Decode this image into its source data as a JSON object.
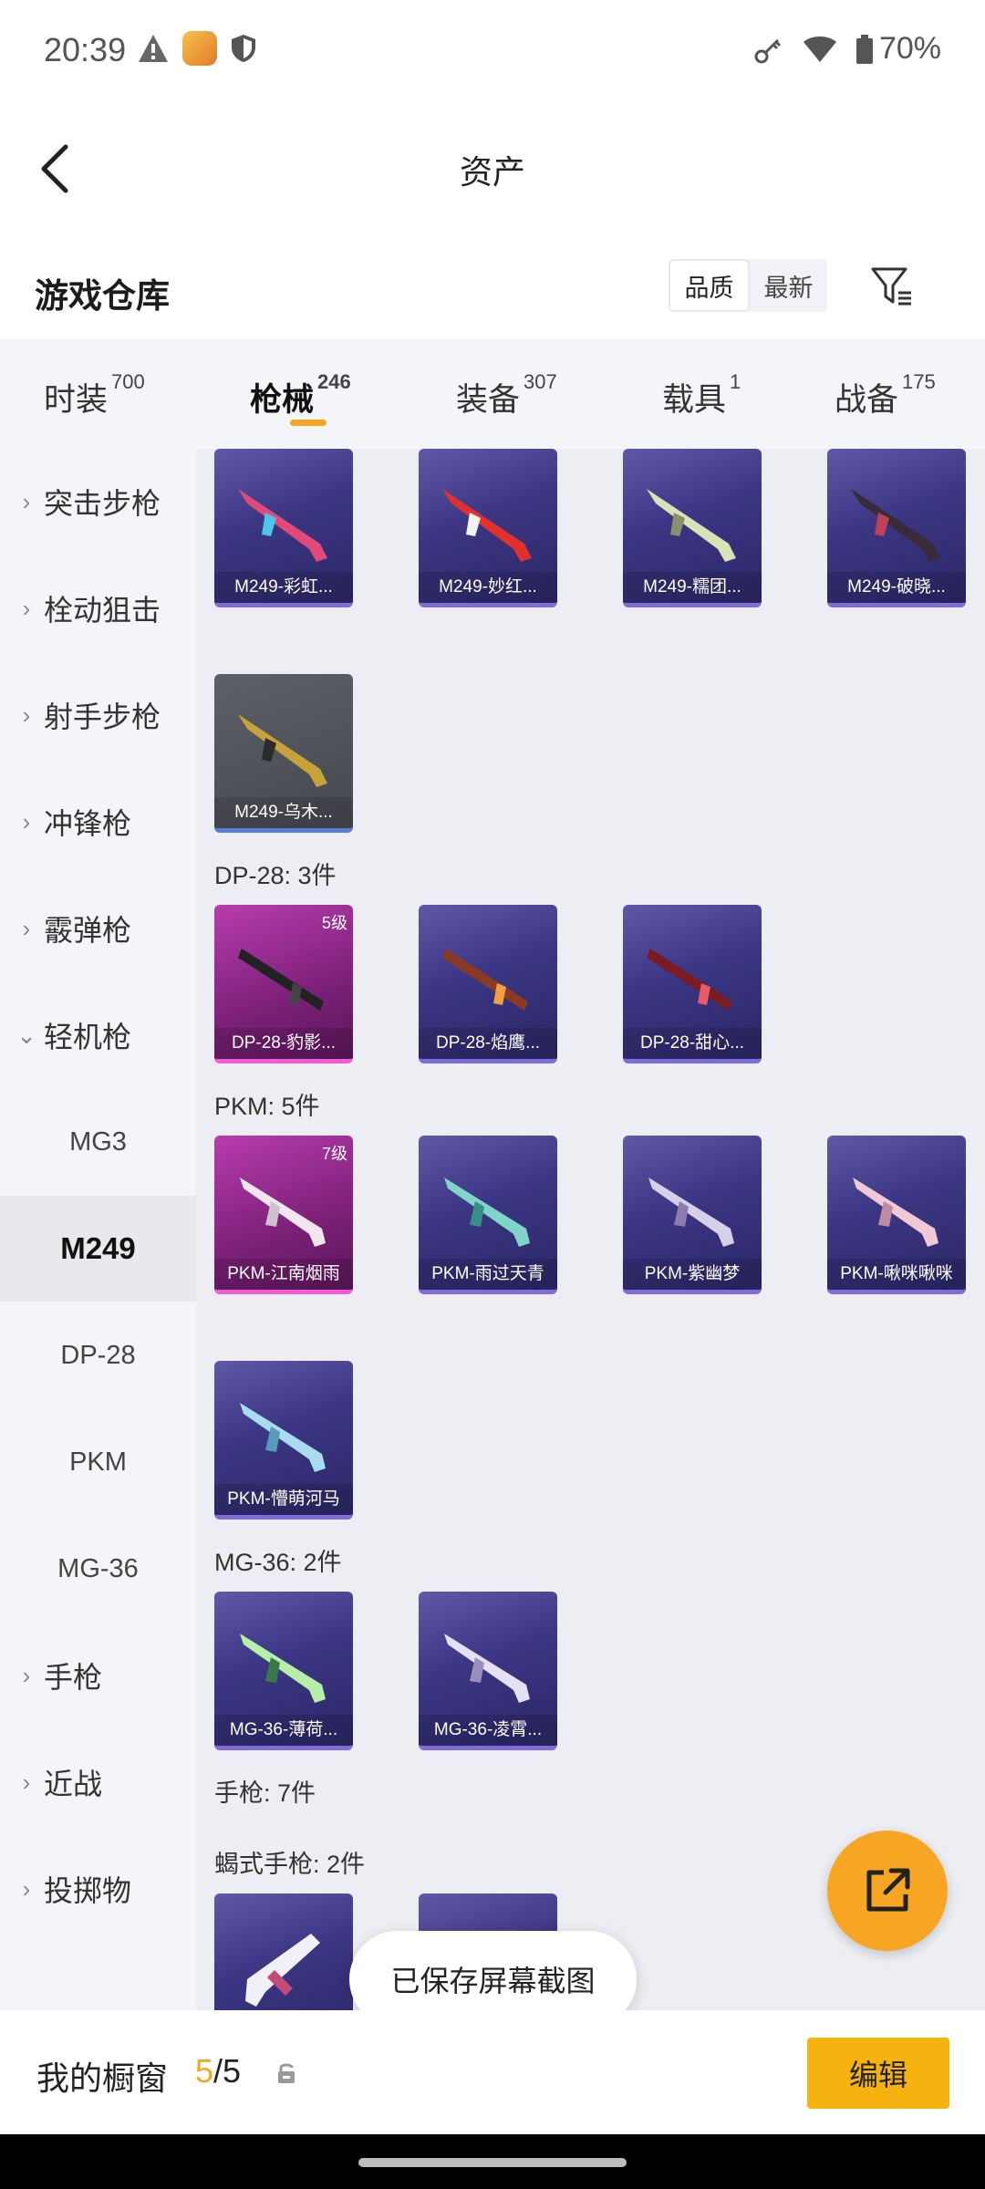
{
  "status": {
    "time": "20:39",
    "battery": "70%",
    "app_badge_text": "和平营地"
  },
  "header": {
    "title": "资产"
  },
  "warehouse": {
    "title": "游戏仓库",
    "sort_options": [
      "品质",
      "最新"
    ]
  },
  "tabs": [
    {
      "label": "时装",
      "count": "700"
    },
    {
      "label": "枪械",
      "count": "246"
    },
    {
      "label": "装备",
      "count": "307"
    },
    {
      "label": "载具",
      "count": "1"
    },
    {
      "label": "战备",
      "count": "175"
    }
  ],
  "sidebar": {
    "items": [
      "突击步枪",
      "栓动狙击",
      "射手步枪",
      "冲锋枪",
      "霰弹枪",
      "轻机枪"
    ],
    "sub_items": [
      "MG3",
      "M249",
      "DP-28",
      "PKM",
      "MG-36"
    ],
    "items_after": [
      "手枪",
      "近战",
      "投掷物"
    ]
  },
  "content": {
    "m249_row1": [
      "M249-彩虹...",
      "M249-妙红...",
      "M249-糯团...",
      "M249-破晓..."
    ],
    "m249_row2": [
      "M249-乌木..."
    ],
    "dp28_header": "DP-28: 3件",
    "dp28": [
      "DP-28-豹影...",
      "DP-28-焰鹰...",
      "DP-28-甜心..."
    ],
    "dp28_badge": "5级",
    "pkm_header": "PKM: 5件",
    "pkm_row1": [
      "PKM-江南烟雨",
      "PKM-雨过天青",
      "PKM-紫幽梦",
      "PKM-啾咪啾咪"
    ],
    "pkm_badge": "7级",
    "pkm_row2": [
      "PKM-懵萌河马"
    ],
    "mg36_header": "MG-36: 2件",
    "mg36": [
      "MG-36-薄荷...",
      "MG-36-凌霄..."
    ],
    "pistol_header": "手枪: 7件",
    "scorpion_header": "蝎式手枪: 2件"
  },
  "toast": "已保存屏幕截图",
  "bottom": {
    "showcase_label": "我的橱窗",
    "current": "5",
    "total": "5",
    "edit_label": "编辑"
  }
}
